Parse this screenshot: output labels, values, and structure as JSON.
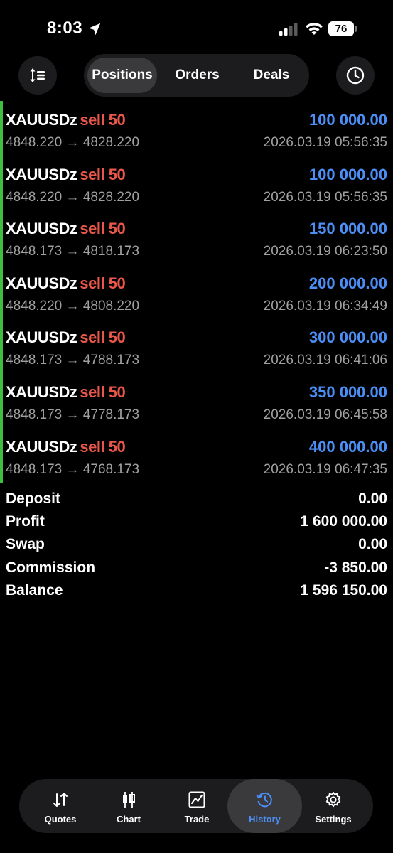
{
  "status_bar": {
    "time": "8:03",
    "battery": "76"
  },
  "toolbar": {
    "tabs": [
      {
        "label": "Positions",
        "active": true
      },
      {
        "label": "Orders",
        "active": false
      },
      {
        "label": "Deals",
        "active": false
      }
    ]
  },
  "deals": [
    {
      "symbol": "XAUUSDz",
      "side": "sell 50",
      "amount": "100 000.00",
      "open_price": "4848.220",
      "close_price": "4828.220",
      "arrow": "→",
      "time": "2026.03.19 05:56:35"
    },
    {
      "symbol": "XAUUSDz",
      "side": "sell 50",
      "amount": "100 000.00",
      "open_price": "4848.220",
      "close_price": "4828.220",
      "arrow": "→",
      "time": "2026.03.19 05:56:35"
    },
    {
      "symbol": "XAUUSDz",
      "side": "sell 50",
      "amount": "150 000.00",
      "open_price": "4848.173",
      "close_price": "4818.173",
      "arrow": "→",
      "time": "2026.03.19 06:23:50"
    },
    {
      "symbol": "XAUUSDz",
      "side": "sell 50",
      "amount": "200 000.00",
      "open_price": "4848.220",
      "close_price": "4808.220",
      "arrow": "→",
      "time": "2026.03.19 06:34:49"
    },
    {
      "symbol": "XAUUSDz",
      "side": "sell 50",
      "amount": "300 000.00",
      "open_price": "4848.173",
      "close_price": "4788.173",
      "arrow": "→",
      "time": "2026.03.19 06:41:06"
    },
    {
      "symbol": "XAUUSDz",
      "side": "sell 50",
      "amount": "350 000.00",
      "open_price": "4848.173",
      "close_price": "4778.173",
      "arrow": "→",
      "time": "2026.03.19 06:45:58"
    },
    {
      "symbol": "XAUUSDz",
      "side": "sell 50",
      "amount": "400 000.00",
      "open_price": "4848.173",
      "close_price": "4768.173",
      "arrow": "→",
      "time": "2026.03.19 06:47:35"
    }
  ],
  "summary": [
    {
      "label": "Deposit",
      "value": "0.00"
    },
    {
      "label": "Profit",
      "value": "1 600 000.00"
    },
    {
      "label": "Swap",
      "value": "0.00"
    },
    {
      "label": "Commission",
      "value": "-3 850.00"
    },
    {
      "label": "Balance",
      "value": "1 596 150.00"
    }
  ],
  "bottom_nav": [
    {
      "label": "Quotes",
      "icon": "quotes-icon",
      "active": false
    },
    {
      "label": "Chart",
      "icon": "chart-icon",
      "active": false
    },
    {
      "label": "Trade",
      "icon": "trade-icon",
      "active": false
    },
    {
      "label": "History",
      "icon": "history-icon",
      "active": true
    },
    {
      "label": "Settings",
      "icon": "gear-icon",
      "active": false
    }
  ],
  "colors": {
    "background": "#000000",
    "sell": "#e8574a",
    "amount": "#4b8ef5",
    "active_tab": "#4b8ef5",
    "profit_bar": "#3fbf3f",
    "secondary_text": "#a0a0a0"
  }
}
